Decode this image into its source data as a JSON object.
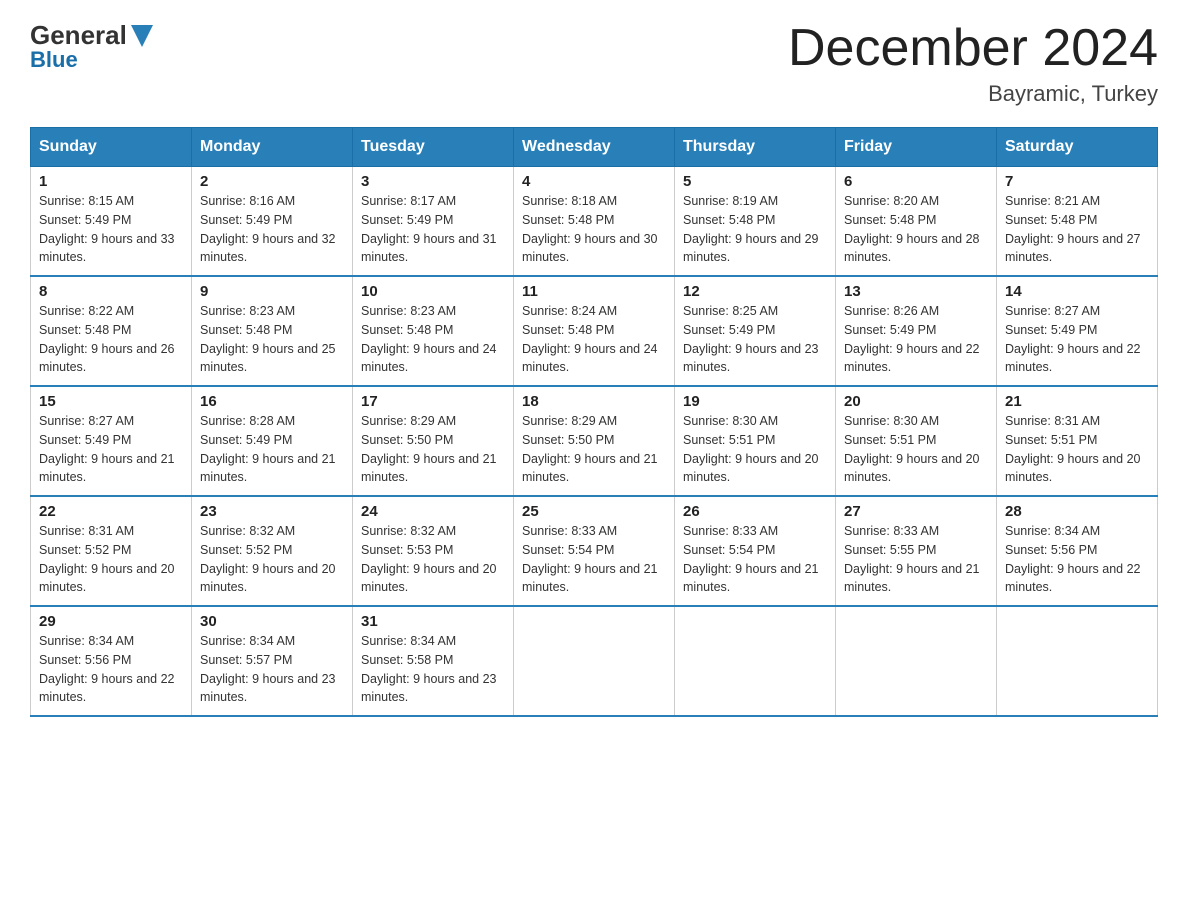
{
  "logo": {
    "line1": "General",
    "line2": "Blue"
  },
  "header": {
    "title": "December 2024",
    "subtitle": "Bayramic, Turkey"
  },
  "weekdays": [
    "Sunday",
    "Monday",
    "Tuesday",
    "Wednesday",
    "Thursday",
    "Friday",
    "Saturday"
  ],
  "weeks": [
    [
      {
        "day": "1",
        "sunrise": "8:15 AM",
        "sunset": "5:49 PM",
        "daylight": "9 hours and 33 minutes."
      },
      {
        "day": "2",
        "sunrise": "8:16 AM",
        "sunset": "5:49 PM",
        "daylight": "9 hours and 32 minutes."
      },
      {
        "day": "3",
        "sunrise": "8:17 AM",
        "sunset": "5:49 PM",
        "daylight": "9 hours and 31 minutes."
      },
      {
        "day": "4",
        "sunrise": "8:18 AM",
        "sunset": "5:48 PM",
        "daylight": "9 hours and 30 minutes."
      },
      {
        "day": "5",
        "sunrise": "8:19 AM",
        "sunset": "5:48 PM",
        "daylight": "9 hours and 29 minutes."
      },
      {
        "day": "6",
        "sunrise": "8:20 AM",
        "sunset": "5:48 PM",
        "daylight": "9 hours and 28 minutes."
      },
      {
        "day": "7",
        "sunrise": "8:21 AM",
        "sunset": "5:48 PM",
        "daylight": "9 hours and 27 minutes."
      }
    ],
    [
      {
        "day": "8",
        "sunrise": "8:22 AM",
        "sunset": "5:48 PM",
        "daylight": "9 hours and 26 minutes."
      },
      {
        "day": "9",
        "sunrise": "8:23 AM",
        "sunset": "5:48 PM",
        "daylight": "9 hours and 25 minutes."
      },
      {
        "day": "10",
        "sunrise": "8:23 AM",
        "sunset": "5:48 PM",
        "daylight": "9 hours and 24 minutes."
      },
      {
        "day": "11",
        "sunrise": "8:24 AM",
        "sunset": "5:48 PM",
        "daylight": "9 hours and 24 minutes."
      },
      {
        "day": "12",
        "sunrise": "8:25 AM",
        "sunset": "5:49 PM",
        "daylight": "9 hours and 23 minutes."
      },
      {
        "day": "13",
        "sunrise": "8:26 AM",
        "sunset": "5:49 PM",
        "daylight": "9 hours and 22 minutes."
      },
      {
        "day": "14",
        "sunrise": "8:27 AM",
        "sunset": "5:49 PM",
        "daylight": "9 hours and 22 minutes."
      }
    ],
    [
      {
        "day": "15",
        "sunrise": "8:27 AM",
        "sunset": "5:49 PM",
        "daylight": "9 hours and 21 minutes."
      },
      {
        "day": "16",
        "sunrise": "8:28 AM",
        "sunset": "5:49 PM",
        "daylight": "9 hours and 21 minutes."
      },
      {
        "day": "17",
        "sunrise": "8:29 AM",
        "sunset": "5:50 PM",
        "daylight": "9 hours and 21 minutes."
      },
      {
        "day": "18",
        "sunrise": "8:29 AM",
        "sunset": "5:50 PM",
        "daylight": "9 hours and 21 minutes."
      },
      {
        "day": "19",
        "sunrise": "8:30 AM",
        "sunset": "5:51 PM",
        "daylight": "9 hours and 20 minutes."
      },
      {
        "day": "20",
        "sunrise": "8:30 AM",
        "sunset": "5:51 PM",
        "daylight": "9 hours and 20 minutes."
      },
      {
        "day": "21",
        "sunrise": "8:31 AM",
        "sunset": "5:51 PM",
        "daylight": "9 hours and 20 minutes."
      }
    ],
    [
      {
        "day": "22",
        "sunrise": "8:31 AM",
        "sunset": "5:52 PM",
        "daylight": "9 hours and 20 minutes."
      },
      {
        "day": "23",
        "sunrise": "8:32 AM",
        "sunset": "5:52 PM",
        "daylight": "9 hours and 20 minutes."
      },
      {
        "day": "24",
        "sunrise": "8:32 AM",
        "sunset": "5:53 PM",
        "daylight": "9 hours and 20 minutes."
      },
      {
        "day": "25",
        "sunrise": "8:33 AM",
        "sunset": "5:54 PM",
        "daylight": "9 hours and 21 minutes."
      },
      {
        "day": "26",
        "sunrise": "8:33 AM",
        "sunset": "5:54 PM",
        "daylight": "9 hours and 21 minutes."
      },
      {
        "day": "27",
        "sunrise": "8:33 AM",
        "sunset": "5:55 PM",
        "daylight": "9 hours and 21 minutes."
      },
      {
        "day": "28",
        "sunrise": "8:34 AM",
        "sunset": "5:56 PM",
        "daylight": "9 hours and 22 minutes."
      }
    ],
    [
      {
        "day": "29",
        "sunrise": "8:34 AM",
        "sunset": "5:56 PM",
        "daylight": "9 hours and 22 minutes."
      },
      {
        "day": "30",
        "sunrise": "8:34 AM",
        "sunset": "5:57 PM",
        "daylight": "9 hours and 23 minutes."
      },
      {
        "day": "31",
        "sunrise": "8:34 AM",
        "sunset": "5:58 PM",
        "daylight": "9 hours and 23 minutes."
      },
      null,
      null,
      null,
      null
    ]
  ],
  "labels": {
    "sunrise": "Sunrise:",
    "sunset": "Sunset:",
    "daylight": "Daylight:"
  }
}
